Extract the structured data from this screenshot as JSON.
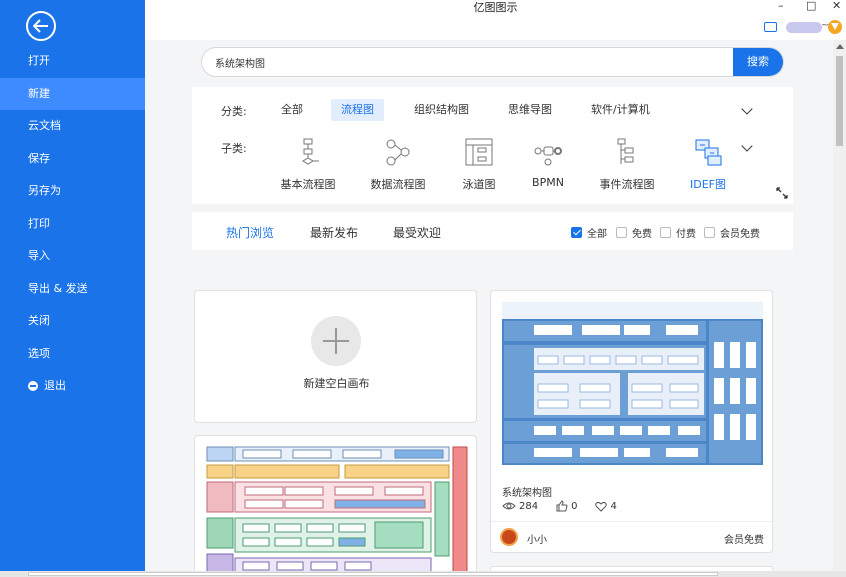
{
  "app": {
    "title": "亿图图示"
  },
  "window_controls": {
    "minimize": "–",
    "maximize": "□",
    "close": "✕"
  },
  "sidebar": {
    "items": [
      {
        "label": "打开",
        "active": false
      },
      {
        "label": "新建",
        "active": true
      },
      {
        "label": "云文档",
        "active": false
      },
      {
        "label": "保存",
        "active": false
      },
      {
        "label": "另存为",
        "active": false
      },
      {
        "label": "打印",
        "active": false
      },
      {
        "label": "导入",
        "active": false
      },
      {
        "label": "导出 & 发送",
        "active": false
      },
      {
        "label": "关闭",
        "active": false
      },
      {
        "label": "选项",
        "active": false
      },
      {
        "label": "退出",
        "active": false
      }
    ]
  },
  "search": {
    "value": "系统架构图",
    "button_label": "搜索"
  },
  "category": {
    "label": "分类:",
    "tabs": [
      "全部",
      "流程图",
      "组织结构图",
      "思维导图",
      "软件/计算机"
    ],
    "active_tab": "流程图"
  },
  "subcategory": {
    "label": "子类:",
    "items": [
      "基本流程图",
      "数据流程图",
      "泳道图",
      "BPMN",
      "事件流程图",
      "IDEF图"
    ],
    "active_item": "IDEF图"
  },
  "filter": {
    "tabs": [
      "热门浏览",
      "最新发布",
      "最受欢迎"
    ],
    "active_tab": "热门浏览",
    "checkboxes": [
      {
        "label": "全部",
        "checked": true
      },
      {
        "label": "免费",
        "checked": false
      },
      {
        "label": "付费",
        "checked": false
      },
      {
        "label": "会员免费",
        "checked": false
      }
    ]
  },
  "new_card": {
    "label": "新建空白画布"
  },
  "template_card": {
    "title": "系统架构图",
    "views": "284",
    "likes": "0",
    "favorites": "4",
    "author": "小小",
    "price": "会员免费"
  },
  "colors": {
    "brand": "#1a73e8",
    "sidebar_active": "#3d8bff",
    "thumb_blue": "#4a86c8"
  }
}
